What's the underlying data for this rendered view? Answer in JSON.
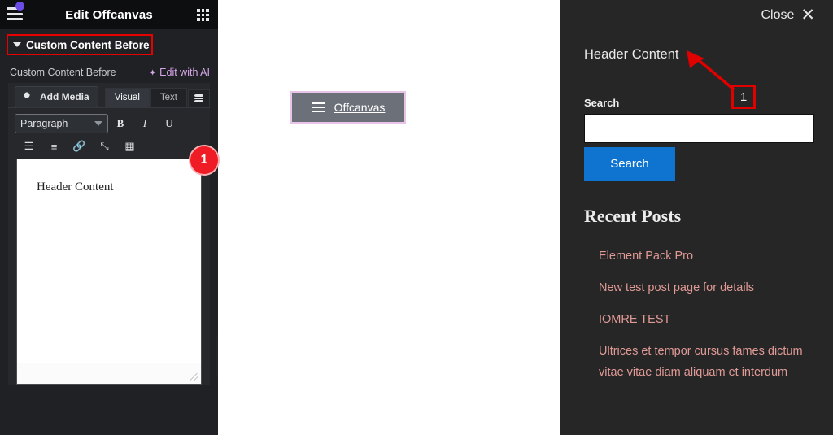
{
  "editor_panel": {
    "title": "Edit Offcanvas",
    "menu_icon": "hamburger-icon",
    "grid_icon": "apps-grid-icon",
    "section": {
      "label": "Custom Content Before",
      "caret": "caret-down-icon"
    },
    "field": {
      "label": "Custom Content Before",
      "ai_link": "Edit with AI",
      "ai_icon": "sparkle-icon"
    },
    "toolbar": {
      "add_media": "Add Media",
      "tabs": [
        "Visual",
        "Text"
      ],
      "active_tab": "Visual",
      "db_icon": "database-stack-icon",
      "format_select": "Paragraph",
      "bold": "B",
      "italic": "I",
      "underline": "U",
      "icons": [
        "bulleted-list-icon",
        "numbered-list-icon",
        "link-icon",
        "fullscreen-icon",
        "toolbar-toggle-icon"
      ]
    },
    "content": "Header Content",
    "collapse_handle_icon": "chevron-left-icon",
    "badge": "1"
  },
  "canvas": {
    "offcanvas_button": {
      "label": "Offcanvas",
      "icon": "hamburger-icon"
    }
  },
  "offcanvas": {
    "close_label": "Close",
    "close_icon": "close-x-icon",
    "heading": "Header Content",
    "search_label": "Search",
    "search_value": "",
    "search_placeholder": "",
    "search_button": "Search",
    "recent_posts_title": "Recent Posts",
    "posts": [
      "Element Pack Pro",
      "New test post page for details",
      "IOMRE TEST",
      "Ultrices et tempor cursus fames dictum vitae vitae diam aliquam et interdum"
    ]
  },
  "annotations": {
    "step_box": "1",
    "arrow_icon": "arrow-up-left-icon"
  },
  "colors": {
    "panel_bg": "#1f2124",
    "header_bg": "#0d0e10",
    "offcanvas_bg": "#262626",
    "accent_red": "#e00000",
    "badge_red": "#ef1c26",
    "search_blue": "#0f74cf",
    "link_pink": "#e09a96",
    "ai_purple": "#d6a6e8",
    "notif_purple": "#6b4ce6",
    "offcanvas_btn_border": "#e8c4e8"
  }
}
